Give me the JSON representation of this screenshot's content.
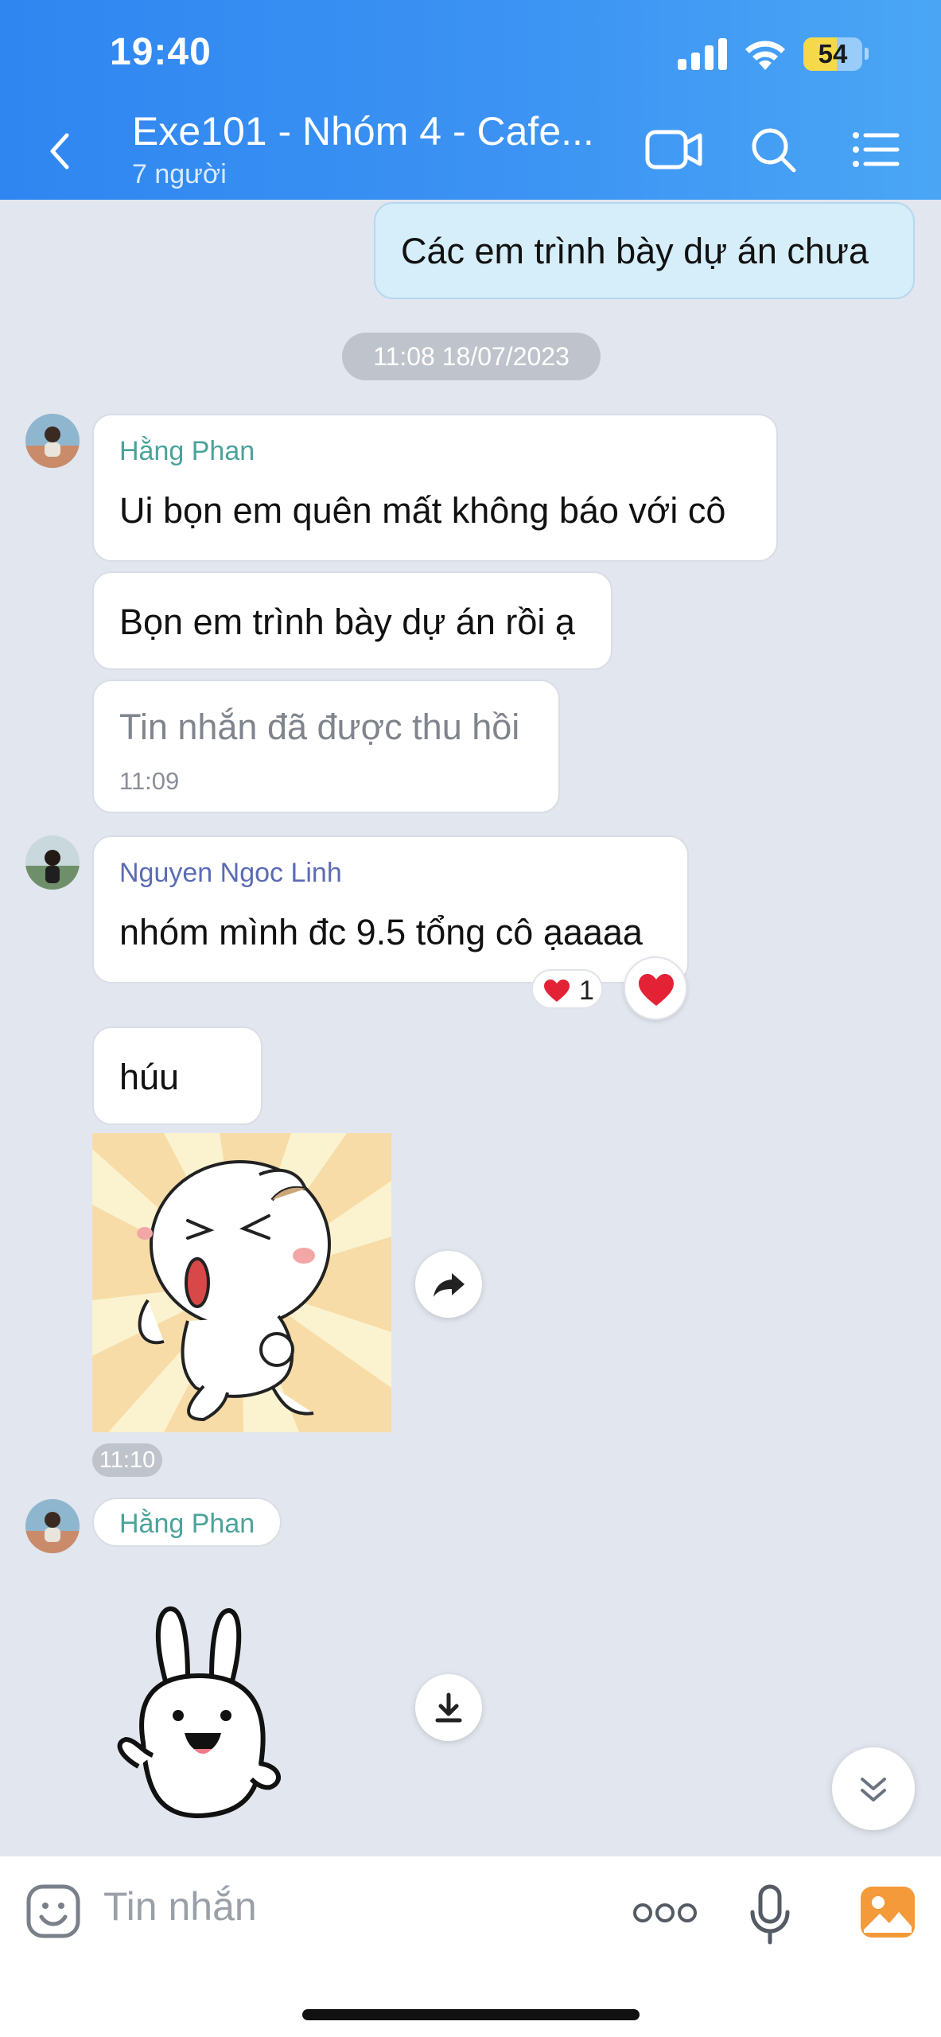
{
  "status_bar": {
    "time": "19:40",
    "battery": "54"
  },
  "header": {
    "title": "Exe101 - Nhóm 4 - Cafe...",
    "subtitle": "7 người"
  },
  "messages": {
    "outgoing_1": "Các  em trình bày dự án chưa",
    "date_separator": "11:08 18/07/2023",
    "group_1": {
      "sender": "Hằng Phan",
      "text_1": "Ui bọn em quên mất không báo với cô",
      "text_2": "Bọn em trình bày dự án rồi ạ",
      "recalled": "Tin nhắn đã được thu hồi",
      "time": "11:09"
    },
    "group_2": {
      "sender": "Nguyen Ngoc Linh",
      "text_1": "nhóm mình đc 9.5 tổng cô ạaaaa",
      "reaction_count": "1",
      "text_2": "húu",
      "time": "11:10"
    },
    "group_3": {
      "sender": "Hằng Phan"
    }
  },
  "composer": {
    "placeholder": "Tin nhắn"
  },
  "colors": {
    "header_blue": "#3c93f3",
    "sender_teal": "#4aa39a",
    "sender_purple": "#5b6bb5",
    "outgoing_bubble": "#d6edfa",
    "background": "#e2e6ee",
    "battery_yellow": "#f5d94a",
    "reaction_red": "#e32236",
    "gallery_orange": "#f59a3b"
  },
  "icons": [
    "back-chevron-icon",
    "video-call-icon",
    "search-icon",
    "menu-list-icon",
    "heart-icon",
    "share-forward-icon",
    "download-icon",
    "chevron-double-down-icon",
    "sticker-emoji-icon",
    "more-dots-icon",
    "microphone-icon",
    "gallery-icon"
  ]
}
